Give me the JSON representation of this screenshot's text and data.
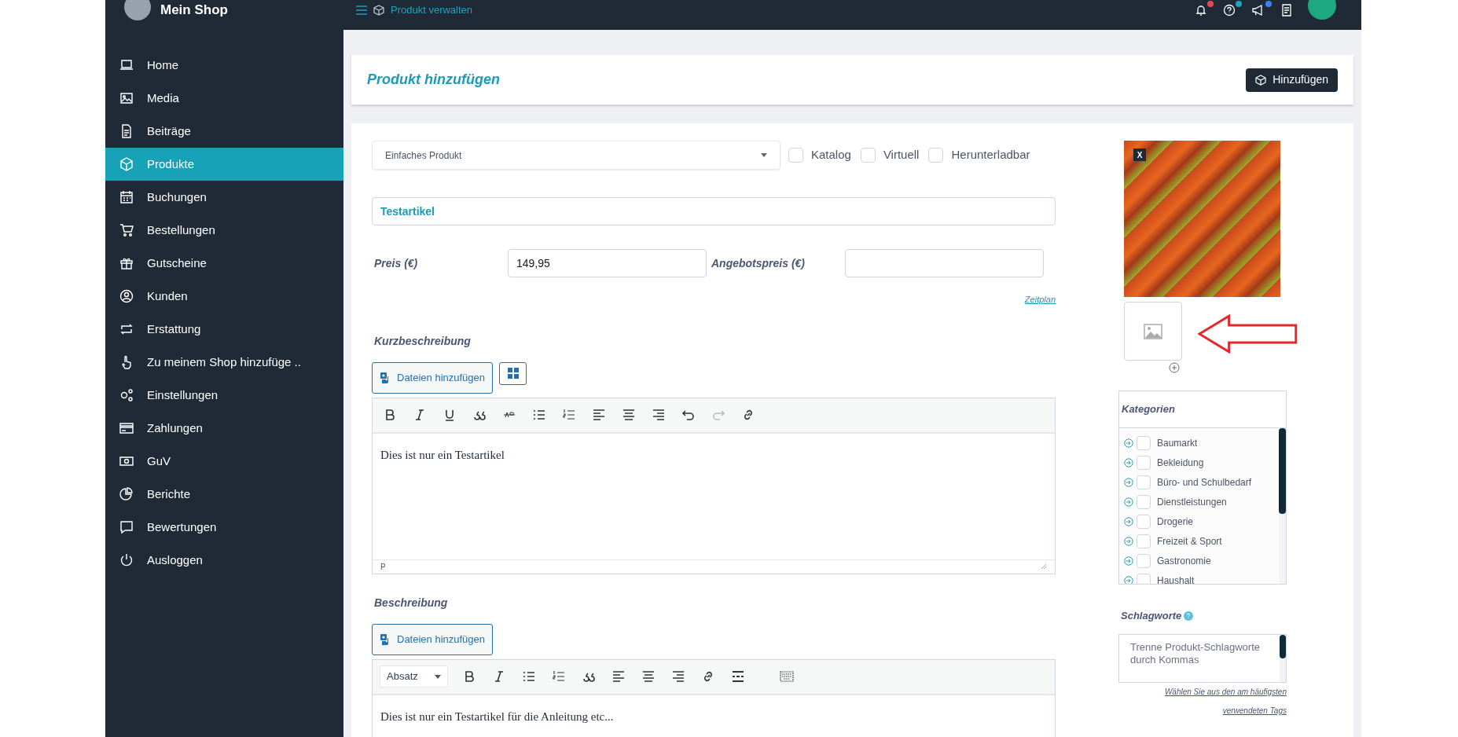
{
  "header": {
    "logo_text": "Mein Shop",
    "breadcrumb": "Produkt verwalten"
  },
  "sidebar": {
    "items": [
      {
        "label": "Home",
        "selected": false
      },
      {
        "label": "Media",
        "selected": false
      },
      {
        "label": "Beiträge",
        "selected": false
      },
      {
        "label": "Produkte",
        "selected": true
      },
      {
        "label": "Buchungen",
        "selected": false
      },
      {
        "label": "Bestellungen",
        "selected": false
      },
      {
        "label": "Gutscheine",
        "selected": false
      },
      {
        "label": "Kunden",
        "selected": false
      },
      {
        "label": "Erstattung",
        "selected": false
      },
      {
        "label": "Zu meinem Shop hinzufüge ..",
        "selected": false
      },
      {
        "label": "Einstellungen",
        "selected": false
      },
      {
        "label": "Zahlungen",
        "selected": false
      },
      {
        "label": "GuV",
        "selected": false
      },
      {
        "label": "Berichte",
        "selected": false
      },
      {
        "label": "Bewertungen",
        "selected": false
      },
      {
        "label": "Ausloggen",
        "selected": false
      }
    ]
  },
  "page_title": "Produkt hinzufügen",
  "add_button": "Hinzufügen",
  "form": {
    "product_type": "Einfaches Produkt",
    "options": [
      {
        "label": "Katalog",
        "checked": false
      },
      {
        "label": "Virtuell",
        "checked": false
      },
      {
        "label": "Herunterladbar",
        "checked": false
      }
    ],
    "title_value": "Testartikel",
    "price_label": "Preis (€)",
    "price_value": "149,95",
    "sale_price_label": "Angebotspreis (€)",
    "schedule_link": "Zeitplan",
    "short_description": {
      "label": "Kurzbeschreibung",
      "add_files": "Dateien hinzufügen",
      "content": "Dies ist nur ein Testartikel",
      "status_path": "P"
    },
    "description": {
      "label": "Beschreibung",
      "add_files": "Dateien hinzufügen",
      "format": "Absatz",
      "content": "Dies ist nur ein Testartikel für die Anleitung etc..."
    }
  },
  "gallery": {
    "remove_label": "X"
  },
  "categories": {
    "title": "Kategorien",
    "items": [
      {
        "label": "Baumarkt",
        "checked": false
      },
      {
        "label": "Bekleidung",
        "checked": false
      },
      {
        "label": "Büro- und Schulbedarf",
        "checked": false
      },
      {
        "label": "Dienstleistungen",
        "checked": false
      },
      {
        "label": "Drogerie",
        "checked": false
      },
      {
        "label": "Freizeit & Sport",
        "checked": false
      },
      {
        "label": "Gastronomie",
        "checked": false
      },
      {
        "label": "Haushalt",
        "checked": false
      }
    ]
  },
  "tags": {
    "title": "Schlagworte",
    "placeholder": "Trenne Produkt-Schlagworte durch Kommas",
    "help_link": "Wählen Sie aus den am häufigsten verwendeten Tags"
  }
}
